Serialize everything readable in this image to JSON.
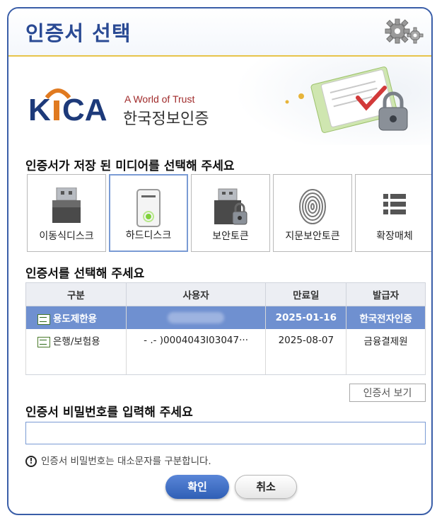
{
  "window": {
    "title": "인증서 선택",
    "accent_color": "#3a5ea8"
  },
  "banner": {
    "logo_text": "KICA",
    "slogan": "A World of Trust",
    "org_name": "한국정보인증",
    "art_icon": "certificate-lock-icon"
  },
  "media": {
    "heading": "인증서가 저장 된 미디어를 선택해 주세요",
    "selected_index": 1,
    "items": [
      {
        "label": "이동식디스크",
        "icon": "usb-drive-icon"
      },
      {
        "label": "하드디스크",
        "icon": "hard-disk-icon"
      },
      {
        "label": "보안토큰",
        "icon": "security-token-icon"
      },
      {
        "label": "지문보안토큰",
        "icon": "fingerprint-icon"
      },
      {
        "label": "확장매체",
        "icon": "list-icon"
      }
    ]
  },
  "certs": {
    "heading": "인증서를 선택해 주세요",
    "columns": [
      "구분",
      "사용자",
      "만료일",
      "발급자"
    ],
    "rows": [
      {
        "type": "용도제한용",
        "user": "",
        "expiry": "2025-01-16",
        "issuer": "한국전자인증",
        "selected": true
      },
      {
        "type": "은행/보험용",
        "user": "- .- )0004043I03047···",
        "expiry": "2025-08-07",
        "issuer": "금융결제원",
        "selected": false
      }
    ],
    "view_button": "인증서 보기"
  },
  "password": {
    "heading": "인증서 비밀번호를 입력해 주세요",
    "value": "",
    "notice": "인증서 비밀번호는 대소문자를 구분합니다."
  },
  "buttons": {
    "ok": "확인",
    "cancel": "취소"
  }
}
